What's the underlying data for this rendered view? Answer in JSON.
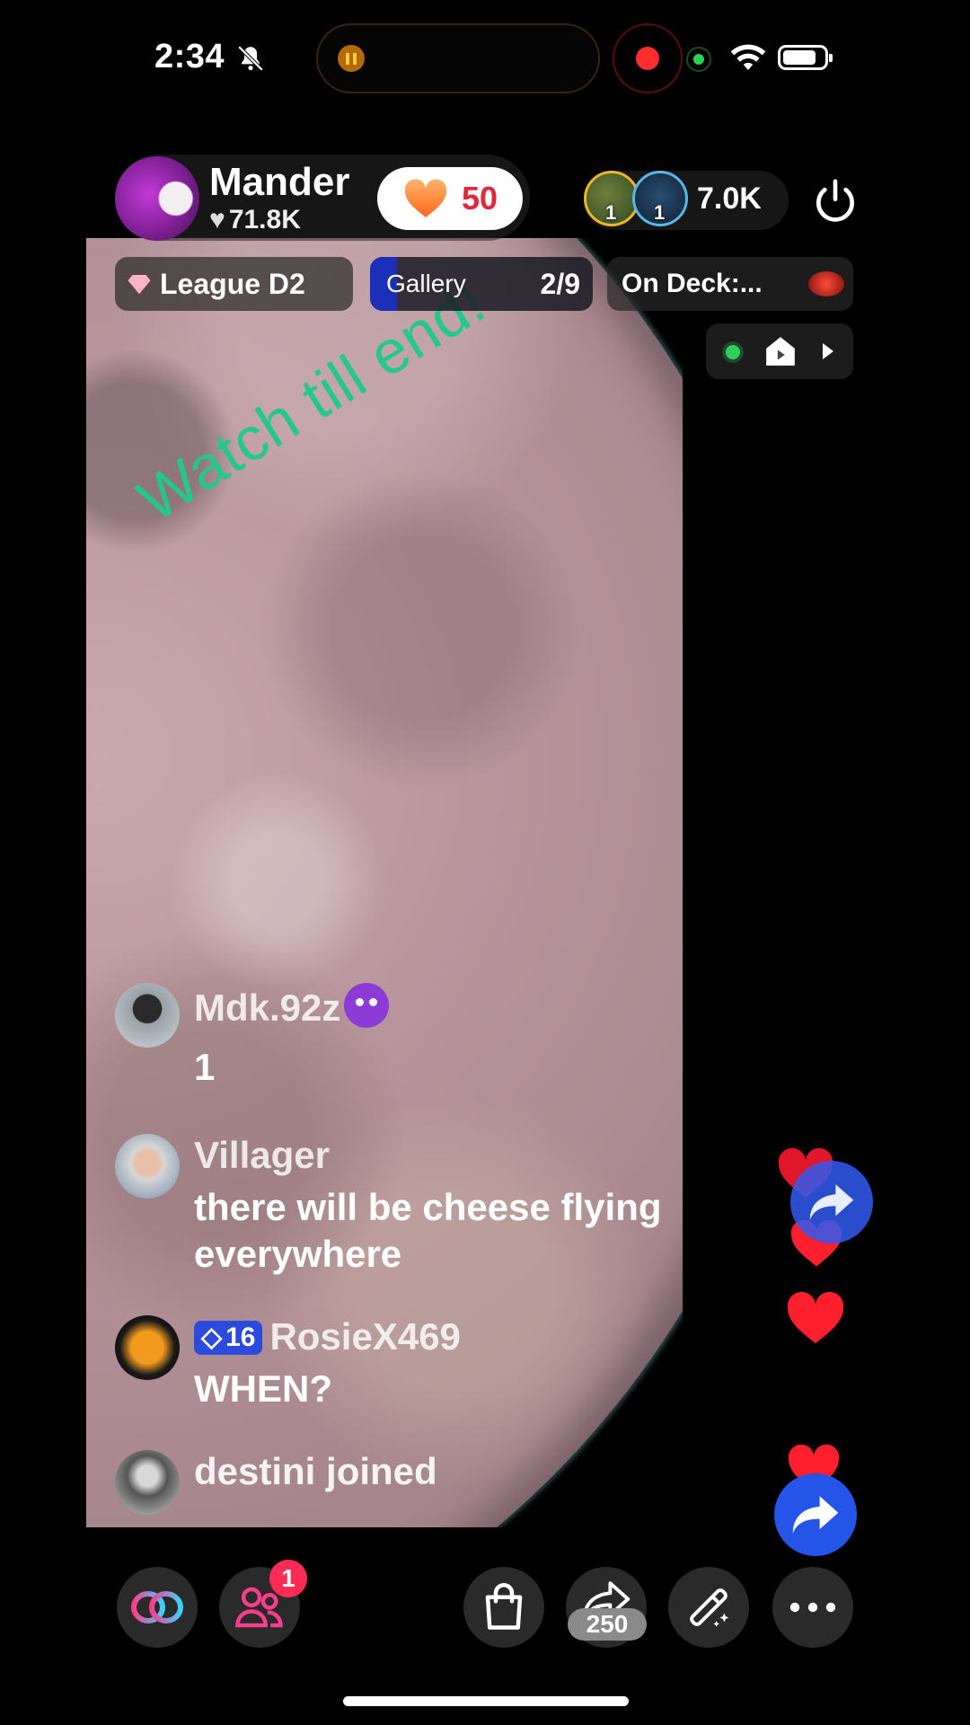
{
  "status_bar": {
    "time": "2:34"
  },
  "host": {
    "name": "Mander",
    "likes": "71.8K",
    "follow_count": "50"
  },
  "viewers": {
    "badges": [
      "1",
      "1"
    ],
    "count": "7.0K"
  },
  "info_row": {
    "league": "League D2",
    "gallery_label": "Gallery",
    "gallery_count": "2/9",
    "gallery_progress": 0.12,
    "on_deck": "On Deck:..."
  },
  "overlay_text": "Watch till end!",
  "comments": [
    {
      "user": "Mdk.92z",
      "text": "1"
    },
    {
      "user": "Villager",
      "text": "there will be cheese flying everywhere"
    },
    {
      "user": "RosieX469",
      "level": "16",
      "text": "WHEN?"
    },
    {
      "user": "destini",
      "text": "joined"
    }
  ],
  "bottom_bar": {
    "friends_notification": "1",
    "share_count": "250"
  },
  "icons": [
    "bell-slash-icon",
    "wifi-icon",
    "battery-icon",
    "power-icon",
    "house-icon",
    "play-icon",
    "heart-icon",
    "share-icon",
    "link-icon",
    "people-icon",
    "shopping-bag-icon",
    "magic-wand-icon",
    "more-icon"
  ],
  "colors": {
    "overlay_text": "#22c88e",
    "share_button": "#2454e8",
    "heart": "#ff1f2d",
    "follow_count": "#e0283a"
  }
}
